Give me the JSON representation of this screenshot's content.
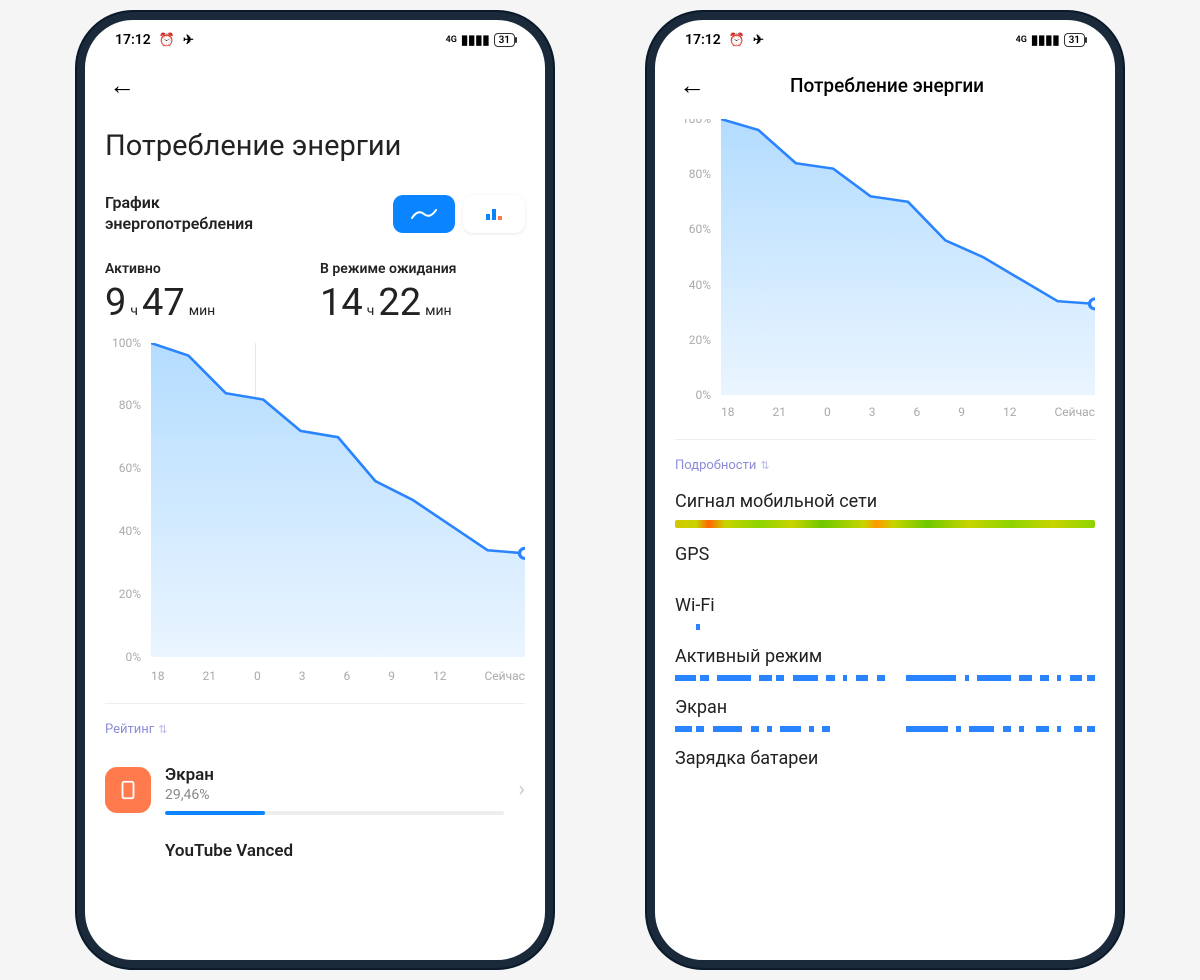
{
  "status": {
    "time": "17:12",
    "battery_pct": "31"
  },
  "screen1": {
    "page_title": "Потребление энергии",
    "graph_label_l1": "График",
    "graph_label_l2": "энергопотребления",
    "active_label": "Активно",
    "active_h": "9",
    "active_m": "47",
    "standby_label": "В режиме ожидания",
    "standby_h": "14",
    "standby_m": "22",
    "unit_h": "ч",
    "unit_m": "мин",
    "rating_label": "Рейтинг",
    "app1_name": "Экран",
    "app1_pct": "29,46%",
    "app2_name": "YouTube Vanced"
  },
  "screen2": {
    "header_title": "Потребление энергии",
    "details_label": "Подробности",
    "row_signal": "Сигнал мобильной сети",
    "row_gps": "GPS",
    "row_wifi": "Wi-Fi",
    "row_active": "Активный режим",
    "row_screen": "Экран",
    "row_charging": "Зарядка батареи"
  },
  "chart_data": {
    "type": "area",
    "x": [
      "18",
      "21",
      "0",
      "3",
      "6",
      "9",
      "12",
      "Сейчас"
    ],
    "values": [
      100,
      96,
      84,
      82,
      72,
      70,
      56,
      50,
      42,
      34,
      33
    ],
    "ylim": [
      0,
      100
    ],
    "y_ticks": [
      "100%",
      "80%",
      "60%",
      "40%",
      "20%",
      "0%"
    ],
    "ylabel": "",
    "xlabel": "",
    "title": ""
  },
  "colors": {
    "accent": "#0a84ff",
    "screen_icon_bg": "#ff7a4d"
  }
}
